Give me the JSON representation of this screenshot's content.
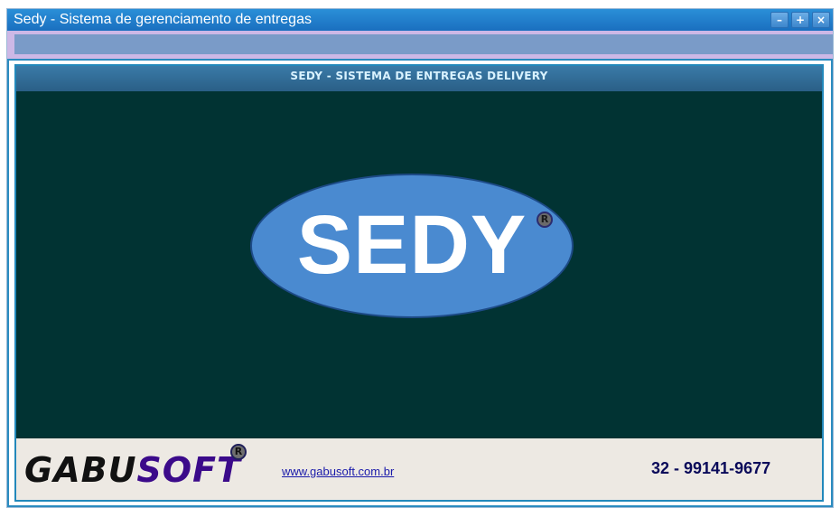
{
  "window": {
    "title": "Sedy - Sistema de gerenciamento de entregas",
    "buttons": {
      "minimize": "–",
      "maximize": "+",
      "close": "×"
    }
  },
  "banner": {
    "title": "SEDY - SISTEMA DE ENTREGAS DELIVERY"
  },
  "splash": {
    "logo_text": "SEDY",
    "registered": "R"
  },
  "footer": {
    "brand_part1": "GABU",
    "brand_part2": "SOFT",
    "registered": "R",
    "website": "www.gabusoft.com.br",
    "phone": "32 - 99141-9677"
  },
  "colors": {
    "titlebar": "#1a6fbf",
    "splash_background": "#013333",
    "logo_ellipse": "#4a8ad0",
    "brand_soft": "#3b0a8a",
    "phone": "#0a0a5a"
  },
  "icons": [
    "minimize-icon",
    "maximize-icon",
    "close-icon",
    "registered-icon"
  ]
}
